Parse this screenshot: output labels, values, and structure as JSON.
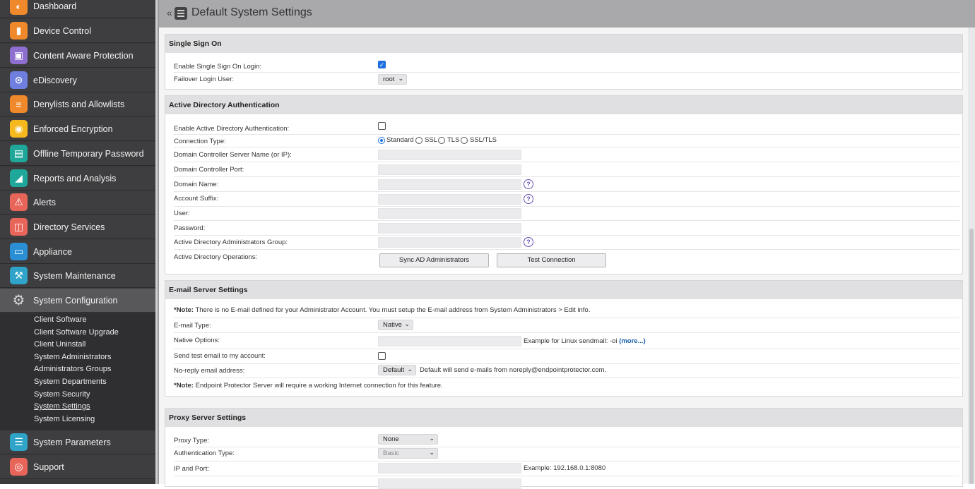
{
  "sidebar": {
    "items": [
      {
        "label": "Dashboard",
        "icon": "dashboard-icon",
        "color": "#f0892b"
      },
      {
        "label": "Device Control",
        "icon": "device-control-icon",
        "color": "#f0892b"
      },
      {
        "label": "Content Aware Protection",
        "icon": "content-aware-icon",
        "color": "#8e6fcf"
      },
      {
        "label": "eDiscovery",
        "icon": "ediscovery-icon",
        "color": "#6f7fe0"
      },
      {
        "label": "Denylists and Allowlists",
        "icon": "denylists-icon",
        "color": "#f0892b"
      },
      {
        "label": "Enforced Encryption",
        "icon": "encryption-icon",
        "color": "#f5b91e"
      },
      {
        "label": "Offline Temporary Password",
        "icon": "offline-password-icon",
        "color": "#1fa89a"
      },
      {
        "label": "Reports and Analysis",
        "icon": "reports-icon",
        "color": "#1fa89a"
      },
      {
        "label": "Alerts",
        "icon": "alerts-icon",
        "color": "#e8655a"
      },
      {
        "label": "Directory Services",
        "icon": "directory-icon",
        "color": "#e8655a"
      },
      {
        "label": "Appliance",
        "icon": "appliance-icon",
        "color": "#2b8fd6"
      },
      {
        "label": "System Maintenance",
        "icon": "maintenance-icon",
        "color": "#2fa4c8"
      },
      {
        "label": "System Configuration",
        "icon": "gear-icon",
        "color": "#6b6b6e"
      },
      {
        "label": "System Parameters",
        "icon": "parameters-icon",
        "color": "#2fa4c8"
      },
      {
        "label": "Support",
        "icon": "support-icon",
        "color": "#e8655a"
      }
    ],
    "submenu": [
      "Client Software",
      "Client Software Upgrade",
      "Client Uninstall",
      "System Administrators",
      "Administrators Groups",
      "System Departments",
      "System Security",
      "System Settings",
      "System Licensing"
    ]
  },
  "header": {
    "collapse": "«",
    "title": "Default System Settings"
  },
  "sso": {
    "title": "Single Sign On",
    "enable_label": "Enable Single Sign On Login:",
    "failover_label": "Failover Login User:",
    "failover_value": "root"
  },
  "ad": {
    "title": "Active Directory Authentication",
    "enable_label": "Enable Active Directory Authentication:",
    "connection_label": "Connection Type:",
    "connection_options": [
      "Standard",
      "SSL",
      "TLS",
      "SSL/TLS"
    ],
    "dc_server_label": "Domain Controller Server Name (or IP):",
    "dc_port_label": "Domain Controller Port:",
    "domain_name_label": "Domain Name:",
    "account_suffix_label": "Account Suffix:",
    "user_label": "User:",
    "password_label": "Password:",
    "admins_group_label": "Active Directory Administrators Group:",
    "operations_label": "Active Directory Operations:",
    "sync_button": "Sync AD Administrators",
    "test_button": "Test Connection",
    "help_glyph": "?"
  },
  "email": {
    "title": "E-mail Server Settings",
    "note1_prefix": "*Note:",
    "note1_text": "There is no E-mail defined for your Administrator Account. You must setup the E-mail address from System Administrators > Edit info.",
    "type_label": "E-mail Type:",
    "type_value": "Native",
    "native_label": "Native Options:",
    "native_example": "Example for Linux sendmail: -oi",
    "more_link": "(more...)",
    "test_label": "Send test email to my account:",
    "noreply_label": "No-reply email address:",
    "noreply_value": "Default",
    "noreply_text": "Default will send e-mails from noreply@endpointprotector.com.",
    "note2_prefix": "*Note:",
    "note2_text": "Endpoint Protector Server will require a working Internet connection for this feature."
  },
  "proxy": {
    "title": "Proxy Server Settings",
    "type_label": "Proxy Type:",
    "type_value": "None",
    "auth_label": "Authentication Type:",
    "auth_value": "Basic",
    "ip_label": "IP and Port:",
    "ip_example": "Example: 192.168.0.1:8080"
  }
}
